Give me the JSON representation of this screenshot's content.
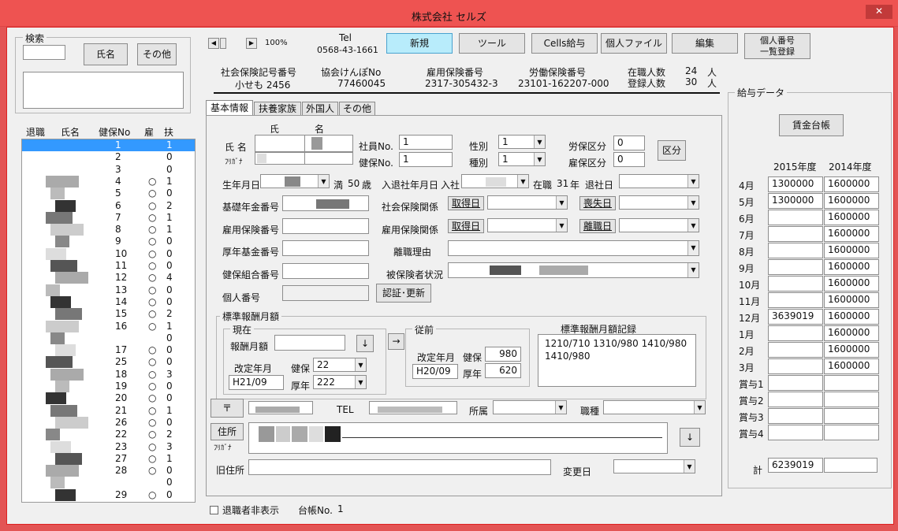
{
  "window": {
    "title": "株式会社 セルズ",
    "close": "✕"
  },
  "search": {
    "legend": "検索",
    "name_btn": "氏名",
    "other_btn": "その他"
  },
  "nav": {
    "prev": "◀",
    "next": "▶",
    "zoom": "100%",
    "tel_label": "Tel",
    "tel": "0568-43-1661"
  },
  "toolbar": {
    "new": "新規",
    "tool": "ツール",
    "cells": "Cells給与",
    "personal_file": "個人ファイル",
    "edit": "編集",
    "mynumber": "個人番号\n一覧登録"
  },
  "insurance": [
    {
      "label": "社会保険記号番号",
      "value": "小せも 2456"
    },
    {
      "label": "協会けんぽNo",
      "value": "77460045"
    },
    {
      "label": "雇用保険番号",
      "value": "2317-305432-3"
    },
    {
      "label": "労働保険番号",
      "value": "23101-162207-000"
    }
  ],
  "counts": {
    "employed_label": "在職人数",
    "employed": "24",
    "employed_unit": "人",
    "registered_label": "登録人数",
    "registered": "30",
    "registered_unit": "人"
  },
  "list": {
    "headers": [
      "退職",
      "氏名",
      "健保No",
      "雇",
      "扶"
    ],
    "rows": [
      {
        "no": "1",
        "koyo": "",
        "fu": "1"
      },
      {
        "no": "2",
        "koyo": "",
        "fu": "0"
      },
      {
        "no": "3",
        "koyo": "",
        "fu": "0"
      },
      {
        "no": "4",
        "koyo": "○",
        "fu": "1"
      },
      {
        "no": "5",
        "koyo": "○",
        "fu": "0"
      },
      {
        "no": "6",
        "koyo": "○",
        "fu": "2"
      },
      {
        "no": "7",
        "koyo": "○",
        "fu": "1"
      },
      {
        "no": "8",
        "koyo": "○",
        "fu": "1"
      },
      {
        "no": "9",
        "koyo": "○",
        "fu": "0"
      },
      {
        "no": "10",
        "koyo": "○",
        "fu": "0"
      },
      {
        "no": "11",
        "koyo": "○",
        "fu": "0"
      },
      {
        "no": "12",
        "koyo": "○",
        "fu": "4"
      },
      {
        "no": "13",
        "koyo": "○",
        "fu": "0"
      },
      {
        "no": "14",
        "koyo": "○",
        "fu": "0"
      },
      {
        "no": "15",
        "koyo": "○",
        "fu": "2"
      },
      {
        "no": "16",
        "koyo": "○",
        "fu": "1"
      },
      {
        "no": "",
        "koyo": "",
        "fu": "0"
      },
      {
        "no": "17",
        "koyo": "○",
        "fu": "0"
      },
      {
        "no": "25",
        "koyo": "○",
        "fu": "0"
      },
      {
        "no": "18",
        "koyo": "○",
        "fu": "3"
      },
      {
        "no": "19",
        "koyo": "○",
        "fu": "0"
      },
      {
        "no": "20",
        "koyo": "○",
        "fu": "0"
      },
      {
        "no": "21",
        "koyo": "○",
        "fu": "1"
      },
      {
        "no": "26",
        "koyo": "○",
        "fu": "0"
      },
      {
        "no": "22",
        "koyo": "○",
        "fu": "2"
      },
      {
        "no": "23",
        "koyo": "○",
        "fu": "3"
      },
      {
        "no": "27",
        "koyo": "○",
        "fu": "1"
      },
      {
        "no": "28",
        "koyo": "○",
        "fu": "0"
      },
      {
        "no": "",
        "koyo": "",
        "fu": "0"
      },
      {
        "no": "29",
        "koyo": "○",
        "fu": "0"
      }
    ]
  },
  "tabs": [
    "基本情報",
    "扶養家族",
    "外国人",
    "その他"
  ],
  "form": {
    "sei": "氏",
    "mei": "名",
    "shimei": "氏 名",
    "furigana": "ﾌﾘｶﾞﾅ",
    "shain_no_label": "社員No.",
    "shain_no": "1",
    "kenpo_no_label": "健保No.",
    "kenpo_no": "1",
    "seibetsu_label": "性別",
    "seibetsu": "1",
    "shubetsu_label": "種別",
    "shubetsu": "1",
    "rouho_label": "労保区分",
    "rouho": "0",
    "koho_label": "雇保区分",
    "koho": "0",
    "kubun_btn": "区分",
    "birth_label": "生年月日",
    "age_prefix": "満",
    "age": "50",
    "age_unit": "歳",
    "nyutaisha_label": "入退社年月日",
    "nyusha_label": "入社",
    "zaishoku": "在職",
    "years": "31",
    "years_unit": "年",
    "taisha_label": "退社日",
    "kiso_label": "基礎年金番号",
    "koyo_no_label": "雇用保険番号",
    "kosei_label": "厚年基金番号",
    "kenpo_kumiai_label": "健保組合番号",
    "kojin_label": "個人番号",
    "shaho_label": "社会保険関係",
    "shutoku1": "取得日",
    "soshitsu": "喪失日",
    "koyo_kankei_label": "雇用保険関係",
    "shutoku2": "取得日",
    "rishoku": "離職日",
    "riyu_label": "離職理由",
    "hihoken_label": "被保険者状況",
    "ninsho_btn": "認証･更新"
  },
  "hyojun": {
    "legend": "標準報酬月額",
    "genzai_legend": "現在",
    "hoshu_label": "報酬月額",
    "hoshu": "",
    "down_btn": "↓",
    "arrow_btn": "→",
    "kaitei_label": "改定年月",
    "kaitei": "H21/09",
    "kenpo_label": "健保",
    "kenpo": "22",
    "kosei_label": "厚年",
    "kosei": "222",
    "juzen_legend": "従前",
    "juzen_kaitei_label": "改定年月",
    "juzen_kaitei": "H20/09",
    "juzen_kenpo_label": "健保",
    "juzen_kenpo": "980",
    "juzen_kosei_label": "厚年",
    "juzen_kosei": "620",
    "kiroku_label": "標準報酬月額記録",
    "kiroku_line1": "1210/710  1310/980 1410/980",
    "kiroku_line2": "1410/980"
  },
  "address": {
    "zip_btn": "〒",
    "tel_label": "TEL",
    "shozoku_label": "所属",
    "shokushu_label": "職種",
    "jusho_btn": "住所",
    "furigana": "ﾌﾘｶﾞﾅ",
    "down_btn": "↓",
    "kyu_label": "旧住所",
    "henko_label": "変更日"
  },
  "footer": {
    "hide_retired": "退職者非表示",
    "daicho_label": "台帳No.",
    "daicho": "1"
  },
  "salary": {
    "legend": "給与データ",
    "ledger_btn": "賃金台帳",
    "year1": "2015年度",
    "year2": "2014年度",
    "rows": [
      {
        "m": "4月",
        "y1": "1300000",
        "y2": "1600000"
      },
      {
        "m": "5月",
        "y1": "1300000",
        "y2": "1600000"
      },
      {
        "m": "6月",
        "y1": "",
        "y2": "1600000"
      },
      {
        "m": "7月",
        "y1": "",
        "y2": "1600000"
      },
      {
        "m": "8月",
        "y1": "",
        "y2": "1600000"
      },
      {
        "m": "9月",
        "y1": "",
        "y2": "1600000"
      },
      {
        "m": "10月",
        "y1": "",
        "y2": "1600000"
      },
      {
        "m": "11月",
        "y1": "",
        "y2": "1600000"
      },
      {
        "m": "12月",
        "y1": "3639019",
        "y2": "1600000"
      },
      {
        "m": "1月",
        "y1": "",
        "y2": "1600000"
      },
      {
        "m": "2月",
        "y1": "",
        "y2": "1600000"
      },
      {
        "m": "3月",
        "y1": "",
        "y2": "1600000"
      },
      {
        "m": "賞与1",
        "y1": "",
        "y2": ""
      },
      {
        "m": "賞与2",
        "y1": "",
        "y2": ""
      },
      {
        "m": "賞与3",
        "y1": "",
        "y2": ""
      },
      {
        "m": "賞与4",
        "y1": "",
        "y2": ""
      }
    ],
    "total_label": "計",
    "total1": "6239019",
    "total2": ""
  }
}
